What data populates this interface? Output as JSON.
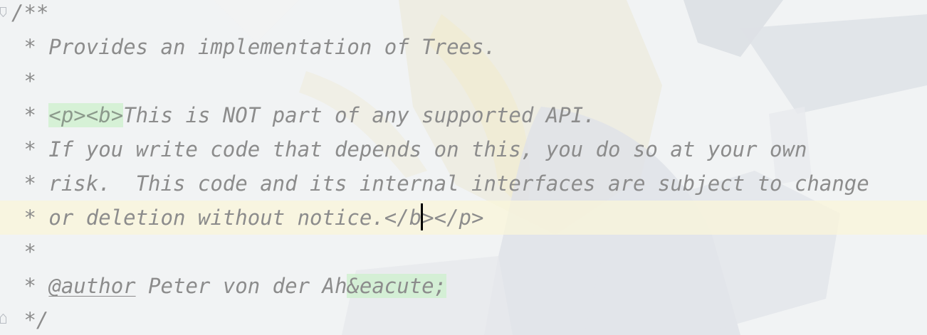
{
  "editor": {
    "lines": [
      {
        "text": "/**"
      },
      {
        "text": " * Provides an implementation of Trees."
      },
      {
        "text": " *"
      },
      {
        "prefix": " * ",
        "tag": "<p><b>",
        "text": "This is NOT part of any supported API."
      },
      {
        "text": " * If you write code that depends on this, you do so at your own"
      },
      {
        "text": " * risk.  This code and its internal interfaces are subject to change"
      },
      {
        "prefix": " * or deletion without notice.</",
        "after_caret": "b></p>"
      },
      {
        "text": " *"
      },
      {
        "prefix": " * ",
        "javadoc_tag": "@author",
        "text": " Peter von der Ah",
        "entity": "&eacute;"
      },
      {
        "text": " */"
      }
    ],
    "colors": {
      "comment": "#8c8c8c",
      "tag_highlight": "#ccf0cc",
      "current_line": "#faf6da",
      "caret": "#000000"
    }
  }
}
